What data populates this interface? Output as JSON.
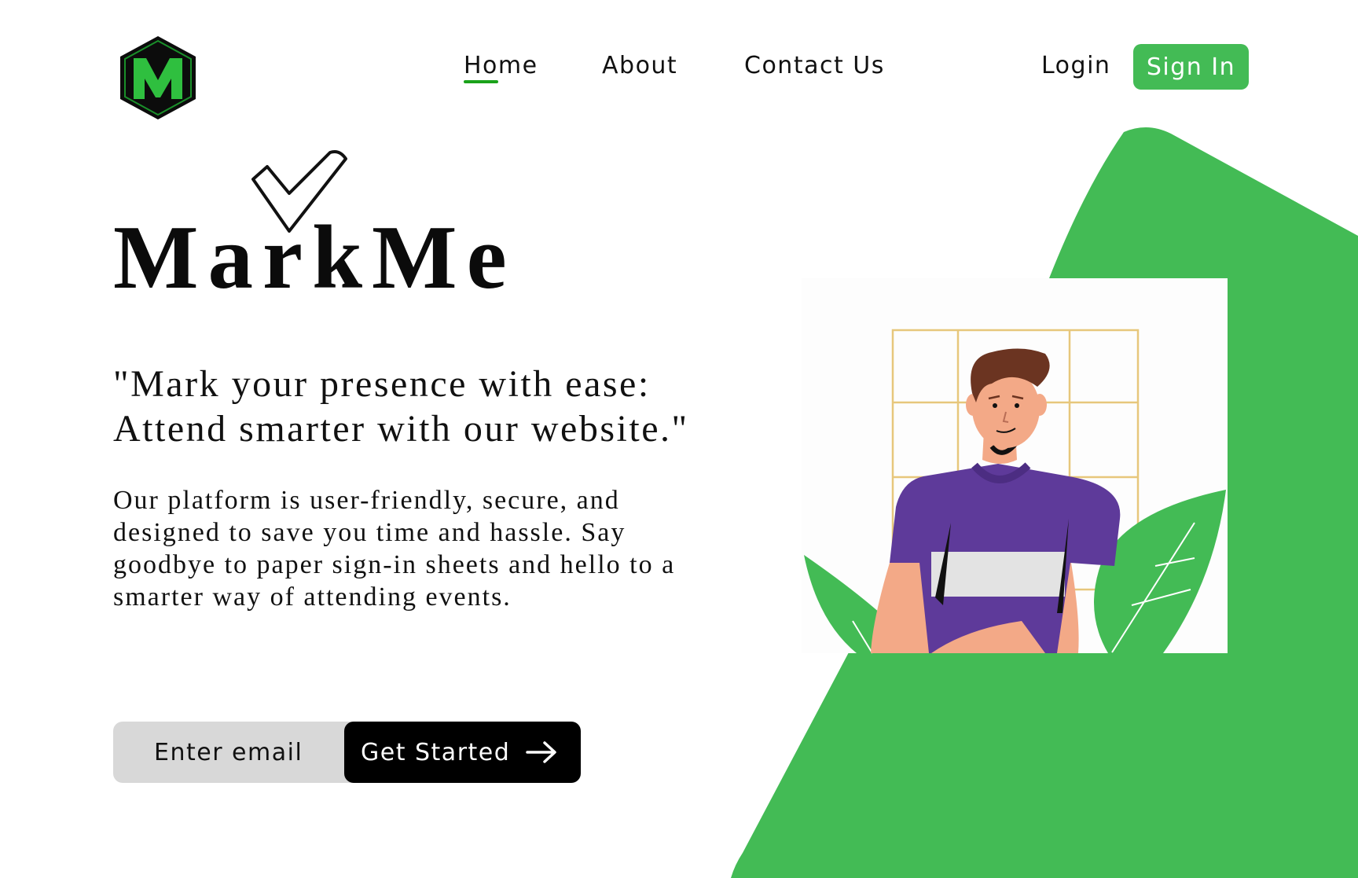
{
  "header": {
    "logo_letter": "M",
    "nav": [
      {
        "label": "Home",
        "active": true
      },
      {
        "label": "About",
        "active": false
      },
      {
        "label": "Contact Us",
        "active": false
      }
    ],
    "login_label": "Login",
    "signin_label": "Sign In"
  },
  "hero": {
    "brand": "MarkMe",
    "quote_line1": "\"Mark your presence with ease:",
    "quote_line2": "Attend smarter with our website.\"",
    "description": "Our platform is user-friendly, secure, and designed to save you time and hassle. Say goodbye to paper sign-in sheets and hello to a smarter way of attending events.",
    "email_placeholder": "Enter email",
    "cta_label": "Get Started"
  },
  "colors": {
    "accent": "#43bb55",
    "active_underline": "#1aa21a",
    "cta_bg": "#000000",
    "email_bg": "#d8d8d8",
    "shirt": "#5e3a9a",
    "hair": "#6b3421",
    "skin": "#f3a987"
  },
  "icons": [
    "logo-hexagon-icon",
    "checkmark-icon",
    "arrow-right-icon"
  ]
}
